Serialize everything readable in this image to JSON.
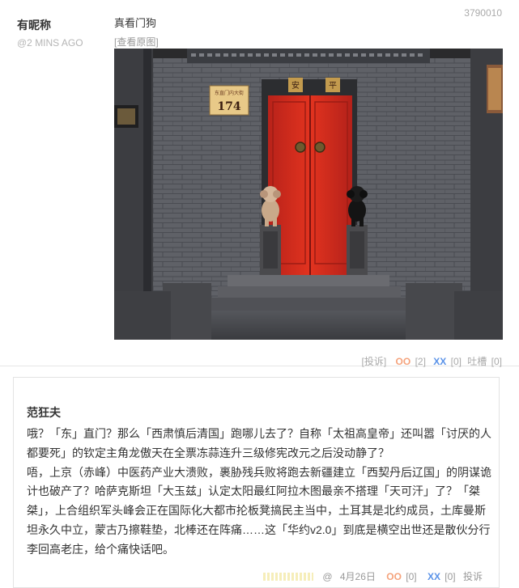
{
  "post": {
    "id": "3790010",
    "author_name": "有昵称",
    "time": "@2 MINS AGO",
    "text": "真看门狗",
    "view_original": "[查看原图]",
    "image": {
      "plaque_line1": "东直门内大街",
      "plaque_number": "174",
      "sign_char_left": "安",
      "sign_char_right": "平"
    },
    "actions": {
      "report": "[投诉]",
      "oo_icon_label": "OO",
      "oo_count": "[2]",
      "xx_icon_label": "XX",
      "xx_count": "[0]",
      "tucao": "吐槽",
      "tucao_count": "[0]"
    }
  },
  "comment": {
    "author": "范狂夫",
    "paragraphs": [
      "哦？「东」直门？那么「西肃慎后清国」跑哪儿去了？自称「太祖高皇帝」还叫嚣「讨厌的人都要死」的钦定主角龙傲天在全票冻蒜连升三级修宪改元之后没动静了？",
      "唔，上京（赤峰）中医药产业大溃败，裹胁残兵败将跑去新疆建立「西契丹后辽国」的阴谋诡计也破产了？哈萨克斯坦「大玉兹」认定太阳最红阿拉木图最亲不搭理「天可汗」了？「桀桀」，上合组织军头峰会正在国际化大都市抡板凳搞民主当中，土耳其是北约成员，土库曼斯坦永久中立，蒙古乃擦鞋垫，北棒还在阵痛……这「华约v2.0」到底是横空出世还是散伙分行李回高老庄，给个痛快话吧。"
    ],
    "footer": {
      "at": "@",
      "date": "4月26日",
      "oo_icon_label": "OO",
      "oo_count": "[0]",
      "xx_icon_label": "XX",
      "xx_count": "[0]",
      "report": "投诉"
    }
  },
  "colors": {
    "door_red": "#d12a1e",
    "wall_gray": "#5e6066",
    "oo_color": "#f5a37c",
    "xx_color": "#5b93e8"
  }
}
